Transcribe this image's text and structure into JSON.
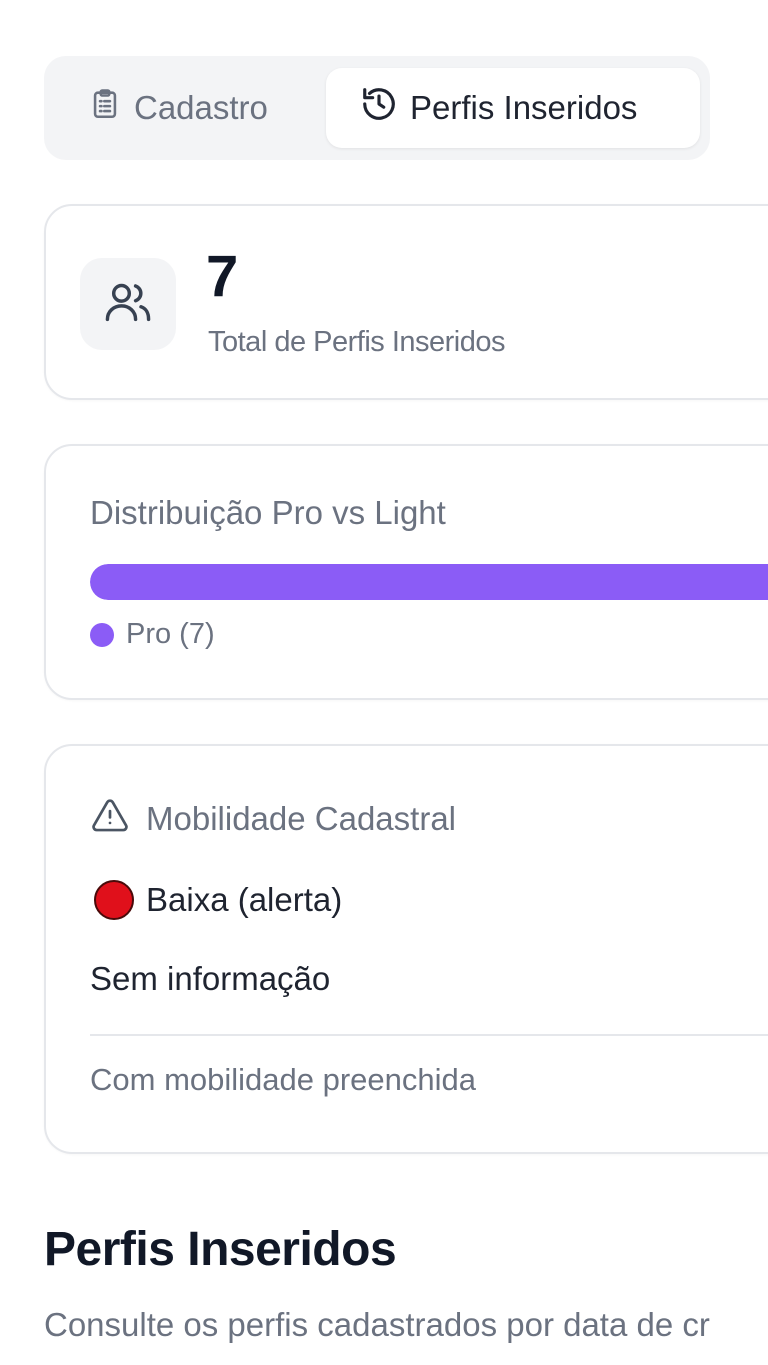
{
  "tabs": [
    {
      "label": "Cadastro",
      "icon": "clipboard-icon",
      "active": false
    },
    {
      "label": "Perfis Inseridos",
      "icon": "history-icon",
      "active": true
    }
  ],
  "summary": {
    "total_value": "7",
    "total_label": "Total de Perfis Inseridos",
    "icon": "users-icon"
  },
  "distribution": {
    "title": "Distribuição Pro vs Light",
    "pro_fraction": 1.0,
    "pro_color": "#8b5cf6",
    "legend": [
      {
        "label": "Pro (7)",
        "color": "#8b5cf6"
      }
    ]
  },
  "mobility": {
    "title": "Mobilidade Cadastral",
    "icon": "warning-triangle-icon",
    "status_label": "Baixa (alerta)",
    "status_color": "#e0101b",
    "info": "Sem informação",
    "footer": "Com mobilidade preenchida"
  },
  "section": {
    "title": "Perfis Inseridos",
    "subtitle": "Consulte os perfis cadastrados por data de cr"
  }
}
